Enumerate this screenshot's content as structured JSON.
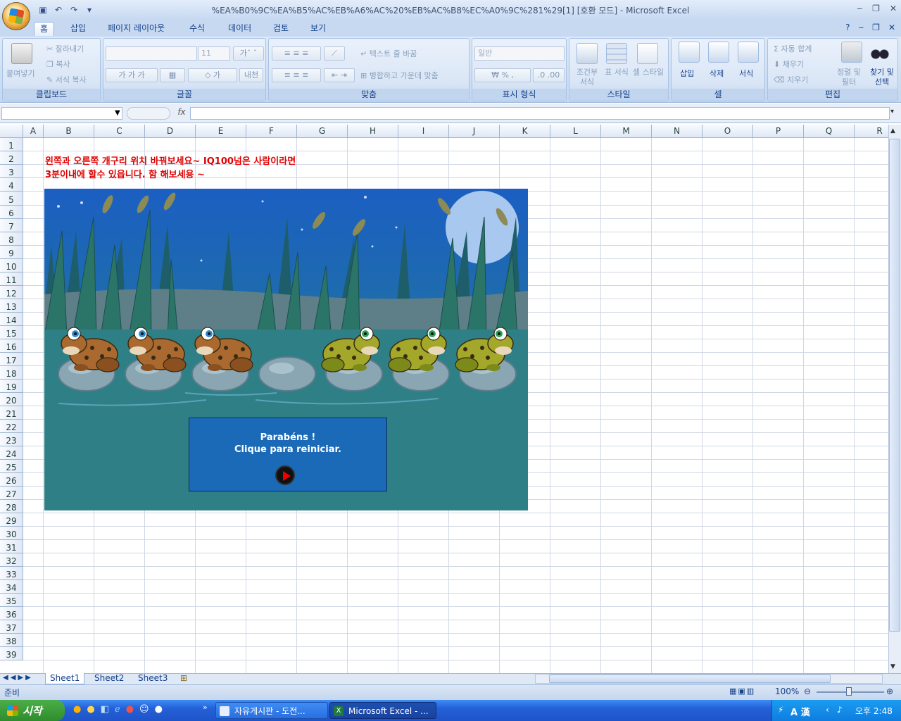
{
  "window": {
    "title": "%EA%B0%9C%EA%B5%AC%EB%A6%AC%20%EB%AC%B8%EC%A0%9C%281%29[1]  [호환 모드] - Microsoft Excel"
  },
  "ribbon_tabs": [
    "홈",
    "삽입",
    "페이지 레이아웃",
    "수식",
    "데이터",
    "검토",
    "보기"
  ],
  "clipboard": {
    "paste": "붙여넣기",
    "cut": "잘라내기",
    "copy": "복사",
    "format_painter": "서식 복사",
    "label": "클립보드"
  },
  "font": {
    "size": "11",
    "label": "글꼴"
  },
  "alignment": {
    "wrap": "텍스트 줄 바꿈",
    "merge": "병합하고 가운데 맞춤",
    "label": "맞춤"
  },
  "number": {
    "format": "일반",
    "label": "표시 형식"
  },
  "styles": {
    "conditional": "조건부 서식",
    "table": "표 서식",
    "cell": "셀 스타일",
    "label": "스타일"
  },
  "cells": {
    "insert": "삽입",
    "delete": "삭제",
    "format": "서식",
    "label": "셀"
  },
  "editing": {
    "autosum": "자동 합계",
    "fill": "채우기",
    "clear": "지우기",
    "sort": "정렬 및 필터",
    "find": "찾기 및 선택",
    "label": "편집"
  },
  "formula_bar": {
    "fx": "fx",
    "value": ""
  },
  "columns": [
    "A",
    "B",
    "C",
    "D",
    "E",
    "F",
    "G",
    "H",
    "I",
    "J",
    "K",
    "L",
    "M",
    "N",
    "O",
    "P",
    "Q",
    "R"
  ],
  "rows": [
    "1",
    "2",
    "3",
    "4",
    "5",
    "6",
    "7",
    "8",
    "9",
    "10",
    "11",
    "12",
    "13",
    "14",
    "15",
    "16",
    "17",
    "18",
    "19",
    "20",
    "21",
    "22",
    "23",
    "24",
    "25",
    "26",
    "27",
    "28",
    "29",
    "30",
    "31",
    "32",
    "33",
    "34",
    "35",
    "36",
    "37",
    "38",
    "39"
  ],
  "cell_text": {
    "line1": "왼쪽과 오른쪽 개구리 위치 바꿔보세요~ IQ100넘은 사람이라면",
    "line2": "3분이내에  할수 있읍니다.    함 해보세용 ~"
  },
  "game": {
    "message1": "Parabéns !",
    "message2": "Clique para reiniciar.",
    "brown_frogs": 3,
    "green_frogs": 3,
    "stones": 7
  },
  "sheets": [
    "Sheet1",
    "Sheet2",
    "Sheet3"
  ],
  "status": {
    "ready": "준비",
    "zoom": "100%"
  },
  "taskbar": {
    "start": "시작",
    "tasks": [
      "자유게시판 - 도전...",
      "Microsoft Excel - ..."
    ],
    "tray_ime": "A 漢",
    "clock": "오후 2:48"
  },
  "colors": {
    "accent": "#15428b",
    "cell_text": "#e00000",
    "taskbar": "#2460d8",
    "start": "#3a9a36",
    "game_water": "#2f7f86",
    "restart_box": "#1a6ab8"
  }
}
